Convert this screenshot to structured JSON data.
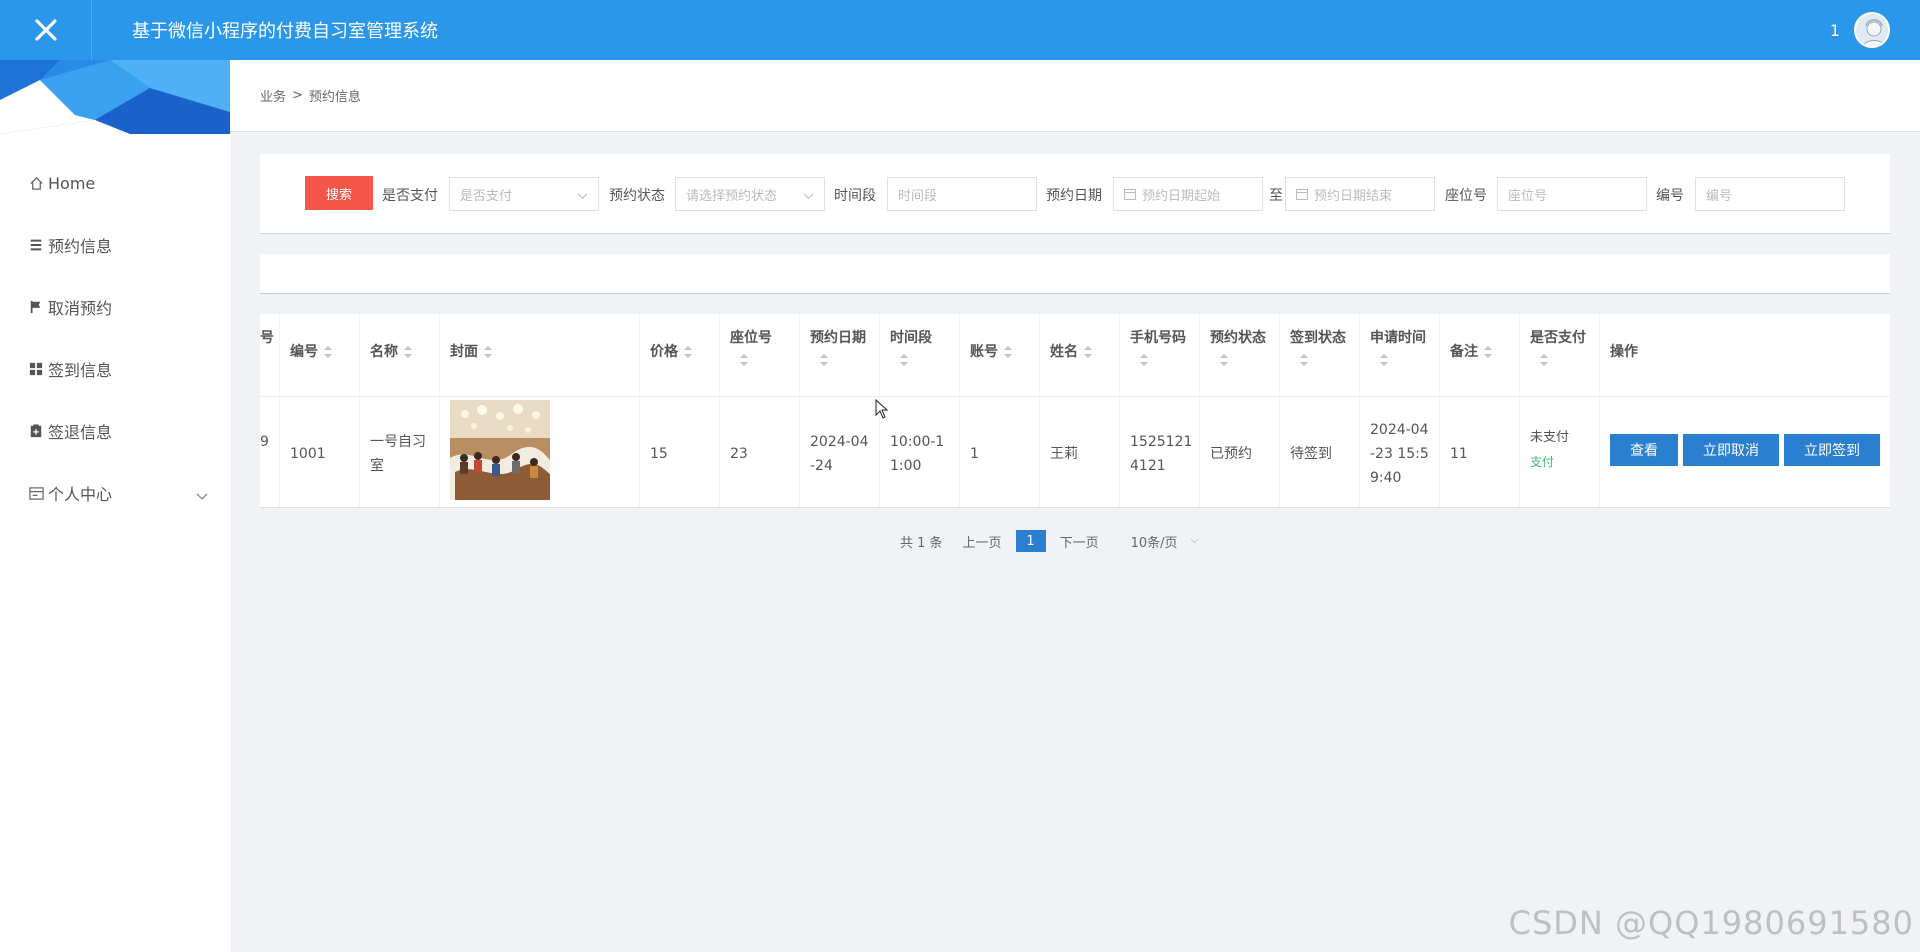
{
  "header": {
    "title": "基于微信小程序的付费自习室管理系统",
    "user": "1"
  },
  "sidebar": {
    "items": [
      {
        "label": "Home",
        "icon": "home-icon"
      },
      {
        "label": "预约信息",
        "icon": "list-icon"
      },
      {
        "label": "取消预约",
        "icon": "flag-icon"
      },
      {
        "label": "签到信息",
        "icon": "grid-icon"
      },
      {
        "label": "签退信息",
        "icon": "clipboard-icon"
      },
      {
        "label": "个人中心",
        "icon": "card-icon"
      }
    ]
  },
  "breadcrumb": {
    "parent": "业务",
    "sep": ">",
    "current": "预约信息"
  },
  "search": {
    "button": "搜索",
    "paid_label": "是否支付",
    "paid_placeholder": "是否支付",
    "status_label": "预约状态",
    "status_placeholder": "请选择预约状态",
    "time_label": "时间段",
    "time_placeholder": "时间段",
    "date_label": "预约日期",
    "date_start_placeholder": "预约日期起始",
    "to": "至",
    "date_end_placeholder": "预约日期结束",
    "seat_label": "座位号",
    "seat_placeholder": "座位号",
    "code_label": "编号",
    "code_placeholder": "编号"
  },
  "table": {
    "headers": {
      "idx_partial": "号",
      "code": "编号",
      "name": "名称",
      "cover": "封面",
      "price": "价格",
      "seat": "座位号",
      "date": "预约日期",
      "time": "时间段",
      "account": "账号",
      "person": "姓名",
      "phone": "手机号码",
      "status": "预约状态",
      "checkin": "签到状态",
      "applied": "申请时间",
      "remark": "备注",
      "paid": "是否支付",
      "ops": "操作"
    },
    "row": {
      "idx_partial": "9",
      "code": "1001",
      "name_l1": "一号自习",
      "name_l2": "室",
      "price": "15",
      "seat": "23",
      "date_l1": "2024-04",
      "date_l2": "-24",
      "time_l1": "10:00-1",
      "time_l2": "1:00",
      "account": "1",
      "person": "王莉",
      "phone_l1": "1525121",
      "phone_l2": "4121",
      "status": "已预约",
      "checkin": "待签到",
      "applied_l1": "2024-04",
      "applied_l2": "-23 15:5",
      "applied_l3": "9:40",
      "remark": "11",
      "paid": "未支付",
      "pay_link": "支付",
      "btn_view": "查看",
      "btn_cancel": "立即取消",
      "btn_checkin": "立即签到"
    }
  },
  "pager": {
    "total": "共 1 条",
    "prev": "上一页",
    "page": "1",
    "next": "下一页",
    "size": "10条/页"
  },
  "watermark": "CSDN @QQ1980691580",
  "colors": {
    "header": "#2a97ea",
    "accent": "#2a7fd0",
    "search": "#f5564a",
    "pay_link": "#3bbd72"
  }
}
